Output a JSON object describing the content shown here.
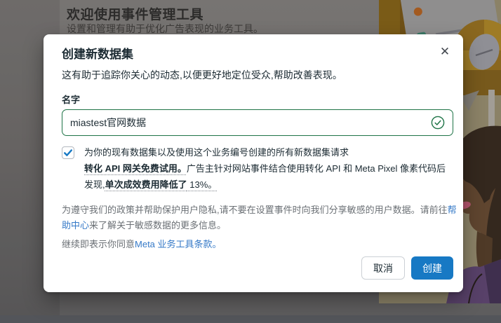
{
  "background": {
    "title": "欢迎使用事件管理工具",
    "subtitle": "设置和管理有助于优化广告表现的业务工具。"
  },
  "modal": {
    "title": "创建新数据集",
    "close_icon_glyph": "✕",
    "description": "这有助于追踪你关心的动态,以便更好地定位受众,帮助改善表现。",
    "name_field": {
      "label": "名字",
      "value": "miastest官网数据",
      "valid_icon": "green-circle-check"
    },
    "trial_checkbox": {
      "checked": true,
      "label_parts": [
        {
          "text": "为你的现有数据集以及使用这个业务编号创建的所有新数据集请求",
          "bold": false,
          "break_after": true
        },
        {
          "text": "转化 API 网关免费试用。",
          "bold": true,
          "underline": "dotted"
        },
        {
          "text": "广告主针对网站事件结合使用转化 API 和 Meta Pixel 像素代码后发现,",
          "bold": false
        },
        {
          "text": "单次成效费用降低了",
          "bold": true,
          "underline": "dotted"
        },
        {
          "text": " 13%。",
          "bold": false,
          "underline": "dotted"
        }
      ]
    },
    "policy_parts": [
      {
        "text": "为遵守我们的政策并帮助保护用户隐私,请不要在设置事件时向我们分享敏感的用户数据。请前往"
      },
      {
        "text": "帮助中心",
        "link": true
      },
      {
        "text": "来了解关于敏感数据的更多信息。"
      }
    ],
    "terms_parts": [
      {
        "text": "继续即表示你同意"
      },
      {
        "text": "Meta 业务工具条款。",
        "link": true
      }
    ],
    "buttons": {
      "cancel": "取消",
      "create": "创建"
    }
  },
  "colors": {
    "accent_blue": "#1779c4",
    "success_green": "#1e7346",
    "link_blue": "#3579c7"
  }
}
